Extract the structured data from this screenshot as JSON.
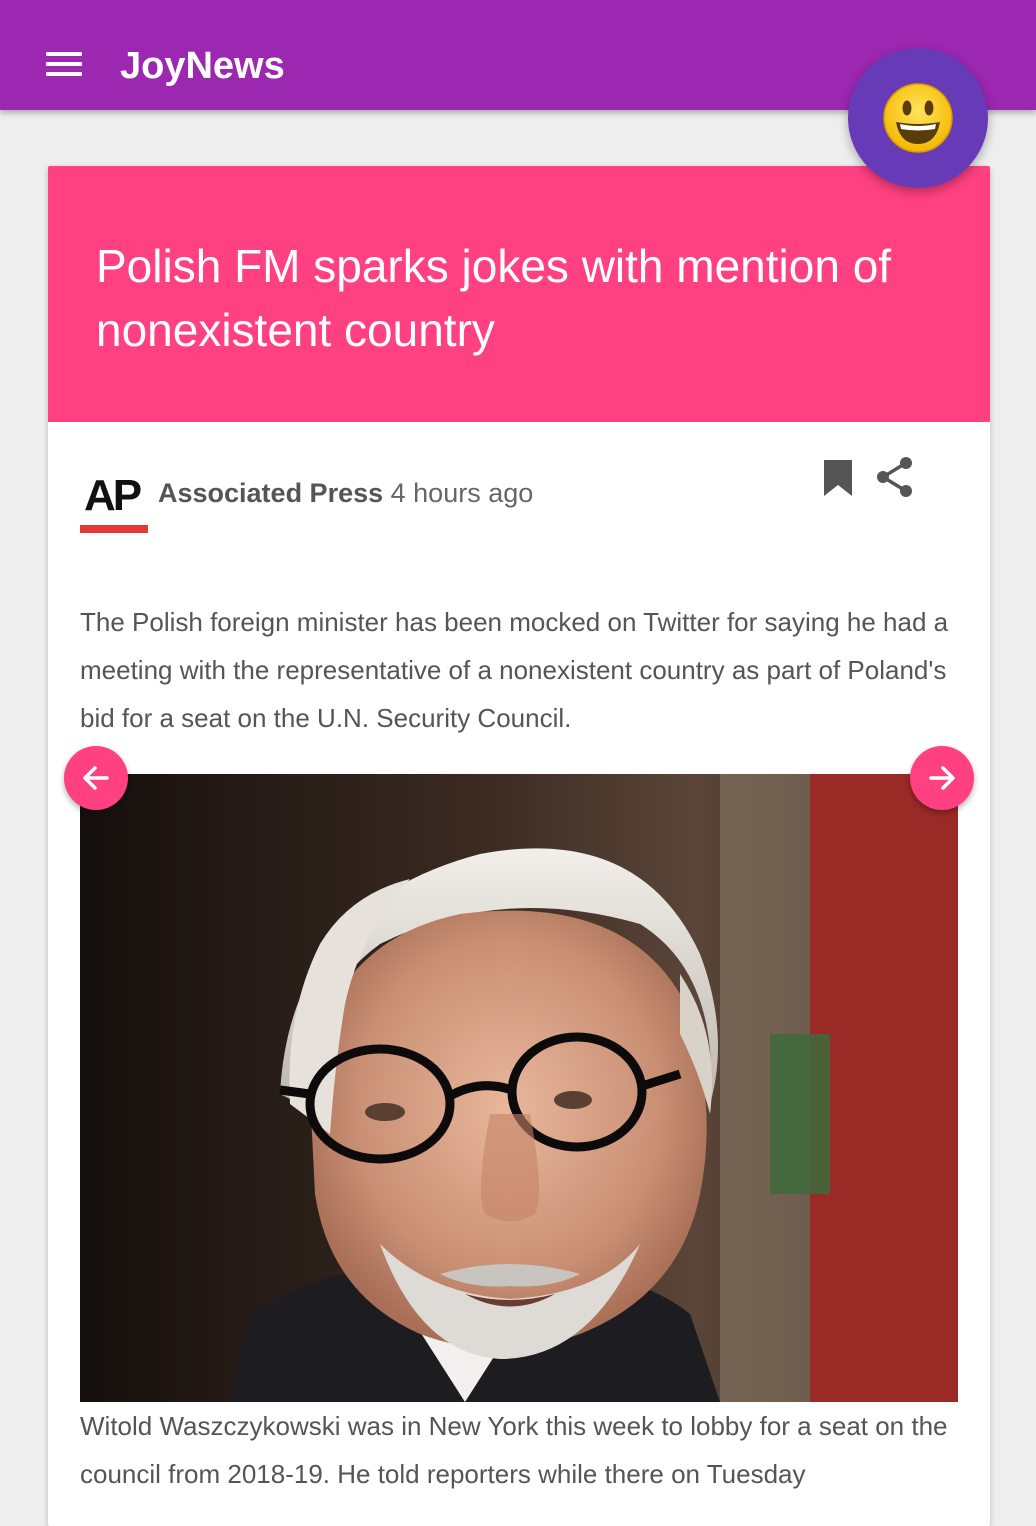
{
  "app": {
    "title": "JoyNews",
    "menu_icon": "hamburger-menu-icon",
    "mood_icon": "smiley-face-icon"
  },
  "colors": {
    "appbar": "#9c27b0",
    "headline_background": "#ff4081",
    "mood_button": "#673ab7",
    "nav_button": "#ff4081",
    "source_underline": "#e53935"
  },
  "article": {
    "headline": "Polish FM sparks jokes with mention of nonexistent country",
    "source_logo_text": "AP",
    "source_name": "Associated Press",
    "time_ago": "4 hours ago",
    "summary": "The Polish foreign minister has been mocked on Twitter for saying he had a meeting with the representative of a nonexistent country as part of Poland's bid for a seat on the U.N. Security Council.",
    "caption": "Witold Waszczykowski was in New York this week to lobby for a seat on the council from 2018-19. He told reporters while there on Tuesday"
  },
  "actions": {
    "bookmark_icon": "bookmark-icon",
    "share_icon": "share-icon"
  },
  "navigation": {
    "prev_icon": "arrow-left-icon",
    "next_icon": "arrow-right-icon"
  }
}
